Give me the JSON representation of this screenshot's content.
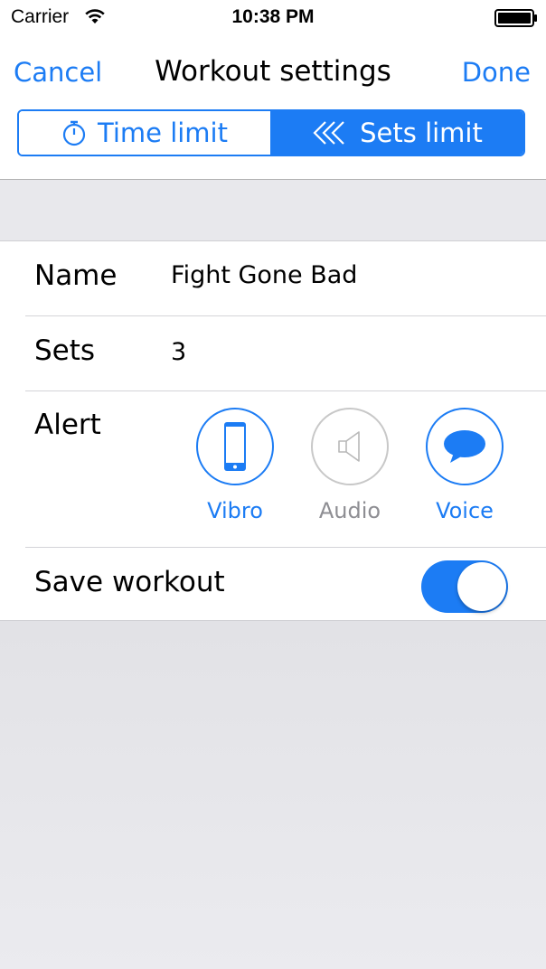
{
  "status_bar": {
    "carrier": "Carrier",
    "time": "10:38 PM",
    "wifi_icon": "wifi-icon",
    "battery_icon": "battery-full-icon"
  },
  "nav": {
    "cancel_label": "Cancel",
    "title": "Workout settings",
    "done_label": "Done"
  },
  "mode_segmented": {
    "options": [
      {
        "label": "Time limit",
        "icon": "stopwatch-icon",
        "selected": false
      },
      {
        "label": "Sets limit",
        "icon": "chevrons-left-icon",
        "selected": true
      }
    ]
  },
  "form": {
    "name_label": "Name",
    "name_value": "Fight Gone Bad",
    "sets_label": "Sets",
    "sets_value": "3",
    "alert_label": "Alert",
    "alert_options": [
      {
        "label": "Vibro",
        "icon": "phone-icon",
        "enabled": true
      },
      {
        "label": "Audio",
        "icon": "speaker-icon",
        "enabled": false
      },
      {
        "label": "Voice",
        "icon": "speech-bubble-icon",
        "enabled": true
      }
    ],
    "save_label": "Save workout",
    "save_enabled": true
  },
  "colors": {
    "accent": "#1c7cf4",
    "disabled": "#c8c8c8",
    "group_background": "#e8e8ec"
  }
}
